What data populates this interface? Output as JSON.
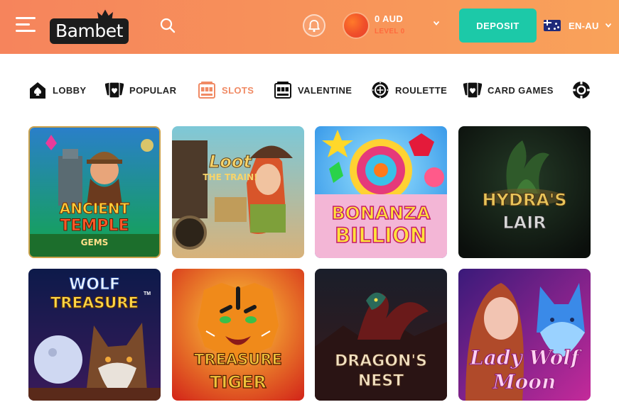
{
  "header": {
    "logo_text": "Bambet",
    "balance": "0 AUD",
    "level": "LEVEL 0",
    "deposit_label": "DEPOSIT",
    "language": "EN-AU",
    "colors": {
      "header_start": "#f6845c",
      "header_end": "#f9a25a",
      "deposit": "#1cc9a8",
      "logo_bg": "#1c1c1c"
    }
  },
  "categories": [
    {
      "label": "LOBBY",
      "icon": "spade-house-icon",
      "active": false
    },
    {
      "label": "POPULAR",
      "icon": "cards-heart-icon",
      "active": false
    },
    {
      "label": "SLOTS",
      "icon": "slot-machine-icon",
      "active": true
    },
    {
      "label": "VALENTINE",
      "icon": "valentine-slot-icon",
      "active": false
    },
    {
      "label": "ROULETTE",
      "icon": "roulette-wheel-icon",
      "active": false
    },
    {
      "label": "CARD GAMES",
      "icon": "card-games-icon",
      "active": false
    },
    {
      "label": "",
      "icon": "poker-chip-icon",
      "active": false
    }
  ],
  "active_color": "#f08a64",
  "games": [
    {
      "title_line1": "ANCIENT",
      "title_line2": "TEMPLE",
      "title_line3": "GEMS"
    },
    {
      "title_line1": "Loot",
      "title_line2": "THE TRAIN!"
    },
    {
      "title_line1": "BONANZA",
      "title_line2": "BILLION"
    },
    {
      "title_line1": "HYDRA'S",
      "title_line2": "LAIR"
    },
    {
      "title_line1": "WOLF",
      "title_line2": "TREASURE",
      "title_mark": "TM"
    },
    {
      "title_line1": "TREASURE",
      "title_line2": "TIGER"
    },
    {
      "title_line1": "DRAGON'S",
      "title_line2": "NEST"
    },
    {
      "title_line1": "Lady Wolf",
      "title_line2": "Moon"
    }
  ]
}
